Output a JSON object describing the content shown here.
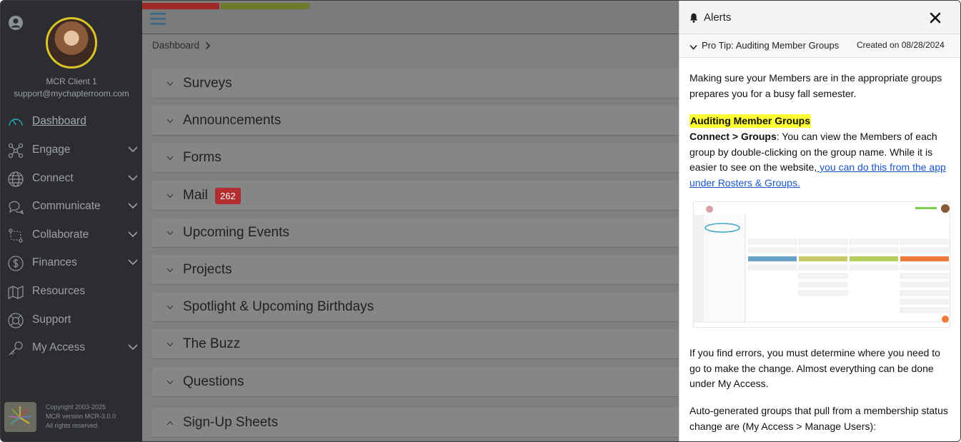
{
  "sidebar": {
    "client_name": "MCR Client 1",
    "client_email": "support@mychapterroom.com",
    "items": [
      {
        "label": "Dashboard",
        "icon": "gauge-icon",
        "expandable": false,
        "active": true
      },
      {
        "label": "Engage",
        "icon": "network-icon",
        "expandable": true
      },
      {
        "label": "Connect",
        "icon": "globe-icon",
        "expandable": true
      },
      {
        "label": "Communicate",
        "icon": "chat-bubbles-icon",
        "expandable": true
      },
      {
        "label": "Collaborate",
        "icon": "collaborate-icon",
        "expandable": true
      },
      {
        "label": "Finances",
        "icon": "dollar-icon",
        "expandable": true
      },
      {
        "label": "Resources",
        "icon": "map-icon",
        "expandable": false
      },
      {
        "label": "Support",
        "icon": "lifebuoy-icon",
        "expandable": false
      },
      {
        "label": "My Access",
        "icon": "key-icon",
        "expandable": true
      }
    ],
    "footer": {
      "line1": "Copyright 2003-2025",
      "line2": "MCR version MCR-3.0.0",
      "line3": "All rights reserved."
    }
  },
  "main": {
    "breadcrumb": "Dashboard",
    "sections": [
      {
        "label": "Surveys",
        "expanded": false
      },
      {
        "label": "Announcements",
        "expanded": false
      },
      {
        "label": "Forms",
        "expanded": false
      },
      {
        "label": "Mail",
        "expanded": false,
        "badge": "262"
      },
      {
        "label": "Upcoming Events",
        "expanded": false
      },
      {
        "label": "Projects",
        "expanded": false
      },
      {
        "label": "Spotlight & Upcoming Birthdays",
        "expanded": false
      },
      {
        "label": "The Buzz",
        "expanded": false
      },
      {
        "label": "Questions",
        "expanded": false
      },
      {
        "label": "Sign-Up Sheets",
        "expanded": true
      }
    ]
  },
  "alerts": {
    "title": "Alerts",
    "tip_title": "Pro Tip: Auditing Member Groups",
    "tip_date": "Created on 08/28/2024",
    "para1": "Making sure your Members are in the appropriate groups prepares you for a busy fall semester.",
    "heading": "Auditing Member Groups",
    "para2_bold": "Connect > Groups",
    "para2_text": ": You can view the Members of each group by double-clicking on the group name. While it is easier to see on the website,",
    "para2_link": " you can do this from the app under Rosters & Groups.",
    "para3": "If you find errors, you must determine where you need to go to make the change.  Almost everything can be done under My Access.",
    "para4": "Auto-generated groups that pull from a membership status change are (My Access > Manage Users):"
  },
  "colors": {
    "sidebar_bg": "#2b2d30",
    "overlay_main": "#7e7f80",
    "badge_red": "#b22d2d",
    "highlight_yellow": "#ffff33",
    "link_blue": "#1a55c9"
  }
}
